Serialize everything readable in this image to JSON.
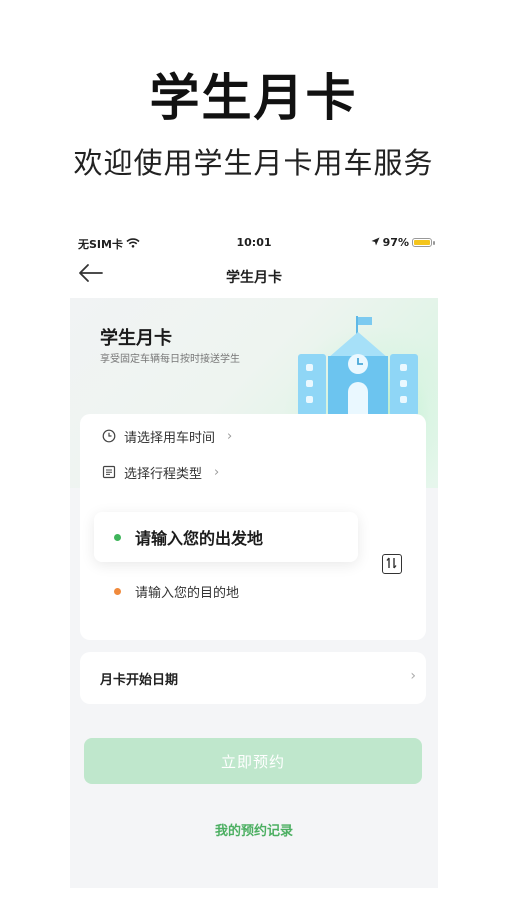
{
  "promo": {
    "title": "学生月卡",
    "subtitle": "欢迎使用学生月卡用车服务"
  },
  "status_bar": {
    "carrier": "无SIM卡",
    "time": "10:01",
    "battery": "97%",
    "battery_level": 0.97
  },
  "nav": {
    "title": "学生月卡",
    "back_icon": "arrow-left-icon"
  },
  "hero": {
    "title": "学生月卡",
    "subtitle": "享受固定车辆每日按时接送学生",
    "illustration": "school-building-icon"
  },
  "trip": {
    "time_option": "请选择用车时间",
    "time_icon": "clock-icon",
    "type_option": "选择行程类型",
    "type_icon": "list-icon",
    "from_placeholder": "请输入您的出发地",
    "to_placeholder": "请输入您的目的地",
    "swap_icon": "swap-vertical-icon"
  },
  "date": {
    "label": "月卡开始日期"
  },
  "actions": {
    "book": "立即预约",
    "records": "我的预约记录"
  },
  "colors": {
    "accent_green": "#4caf62",
    "origin_dot": "#3fb55b",
    "destination_dot": "#f08a3c",
    "button_disabled": "#bfe7cc"
  }
}
